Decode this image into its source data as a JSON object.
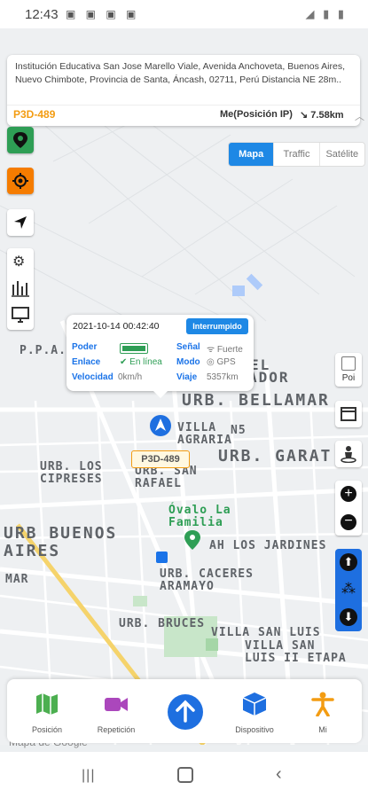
{
  "status_bar": {
    "time": "12:43"
  },
  "address_card": {
    "address": "Institución Educativa San Jose Marello Viale, Avenida Anchoveta, Buenos Aires, Nuevo Chimbote, Provincia de Santa, Áncash, 02711, Perú Distancia NE 28m..",
    "plate": "P3D-489",
    "me_label": "Me(Posición IP)",
    "distance": "7.58km"
  },
  "map_type": {
    "tabs": [
      "Mapa",
      "Traffic",
      "Satélite"
    ],
    "selected": "Mapa"
  },
  "popup": {
    "datetime": "2021-10-14 00:42:40",
    "status_badge": "Interrumpido",
    "poder_label": "Poder",
    "enlace_label": "Enlace",
    "enlace_value": "En línea",
    "velocidad_label": "Velocidad",
    "velocidad_value": "0km/h",
    "senal_label": "Señal",
    "senal_value": "Fuerte",
    "modo_label": "Modo",
    "modo_value": "GPS",
    "viaje_label": "Viaje",
    "viaje_value": "5357km"
  },
  "marker_plate": "P3D-489",
  "poi_label": "Poi",
  "map_labels": {
    "el": "EL",
    "ador": "ADOR",
    "ppao": "P.P.A.O.",
    "bellamar": "URB. BELLAMAR",
    "villa_agraria": "VILLA\nAGRARIA",
    "n5": "N5",
    "garat": "URB. GARAT",
    "los_cipreses": "URB. LOS\nCIPRESES",
    "san_rafael": "URB. SAN\nRAFAEL",
    "buenos_aires": "URB BUENOS\nAIRES",
    "ovalo": "Óvalo La\nFamilia",
    "jardines": "AH LOS JARDINES",
    "caceres": "URB. CACERES\nARAMAYO",
    "bruces": "URB. BRUCES",
    "villa_san_luis": "VILLA SAN LUIS",
    "villa_san_luis_ii": "VILLA SAN\nLUIS II ETAPA",
    "mar": "MAR",
    "google": "Mapa de Google"
  },
  "bottom_nav": [
    {
      "label": "Posición",
      "icon": "map-icon"
    },
    {
      "label": "Repetición",
      "icon": "video-icon"
    },
    {
      "label": "",
      "icon": "arrow-up-icon"
    },
    {
      "label": "Dispositivo",
      "icon": "cube-icon"
    },
    {
      "label": "Mi",
      "icon": "person-icon"
    }
  ],
  "colors": {
    "accent": "#1e88e5",
    "plate": "#f39c12",
    "online": "#2e9e55"
  }
}
